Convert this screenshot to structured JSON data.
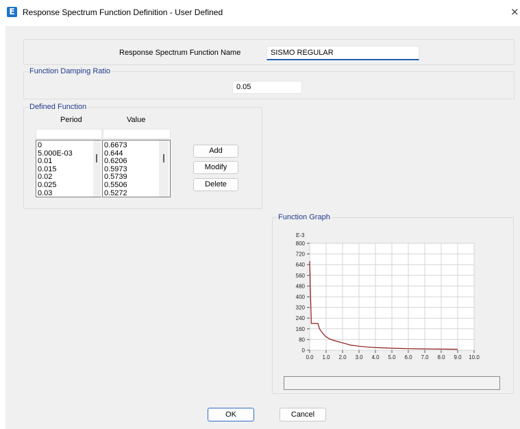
{
  "window": {
    "app_icon_glyph": "E",
    "title": "Response Spectrum Function Definition - User Defined",
    "close_glyph": "×"
  },
  "name_section": {
    "label": "Response Spectrum Function Name",
    "value": "SISMO REGULAR"
  },
  "damping": {
    "group_label": "Function Damping Ratio",
    "value": "0.05"
  },
  "defined_function": {
    "group_label": "Defined Function",
    "col_period": "Period",
    "col_value": "Value",
    "period_input": "",
    "value_input": "",
    "periods": [
      "0",
      "5.000E-03",
      "0.01",
      "0.015",
      "0.02",
      "0.025",
      "0.03"
    ],
    "values": [
      "0.6673",
      "0.644",
      "0.6206",
      "0.5973",
      "0.5739",
      "0.5506",
      "0.5272"
    ],
    "add_label": "Add",
    "modify_label": "Modify",
    "delete_label": "Delete"
  },
  "graph": {
    "group_label": "Function Graph",
    "status_text": ""
  },
  "chart_data": {
    "type": "line",
    "title": "",
    "y_multiplier_label": "E-3",
    "xlim": [
      0,
      10
    ],
    "ylim": [
      0,
      800
    ],
    "x_ticks": [
      "0.0",
      "1.0",
      "2.0",
      "3.0",
      "4.0",
      "5.0",
      "6.0",
      "7.0",
      "8.0",
      "9.0",
      "10.0"
    ],
    "y_ticks": [
      "800",
      "720",
      "640",
      "560",
      "480",
      "400",
      "320",
      "240",
      "160",
      "80",
      "0"
    ],
    "grid": true,
    "line_color": "#8b1a1a",
    "x": [
      0,
      0.005,
      0.01,
      0.015,
      0.02,
      0.025,
      0.03,
      0.05,
      0.08,
      0.1,
      0.15,
      0.5,
      0.6,
      0.8,
      1.0,
      1.2,
      1.5,
      2.0,
      2.5,
      3.0,
      3.5,
      4.0,
      5.0,
      6.0,
      7.0,
      8.0,
      9.0
    ],
    "y": [
      667.3,
      644,
      620.6,
      597.3,
      573.9,
      550.6,
      527.2,
      420,
      300,
      200,
      200,
      200,
      160,
      125,
      100,
      85,
      72,
      55,
      38,
      30,
      24,
      20,
      15,
      12,
      10,
      8,
      7
    ]
  },
  "footer": {
    "ok_label": "OK",
    "cancel_label": "Cancel"
  }
}
